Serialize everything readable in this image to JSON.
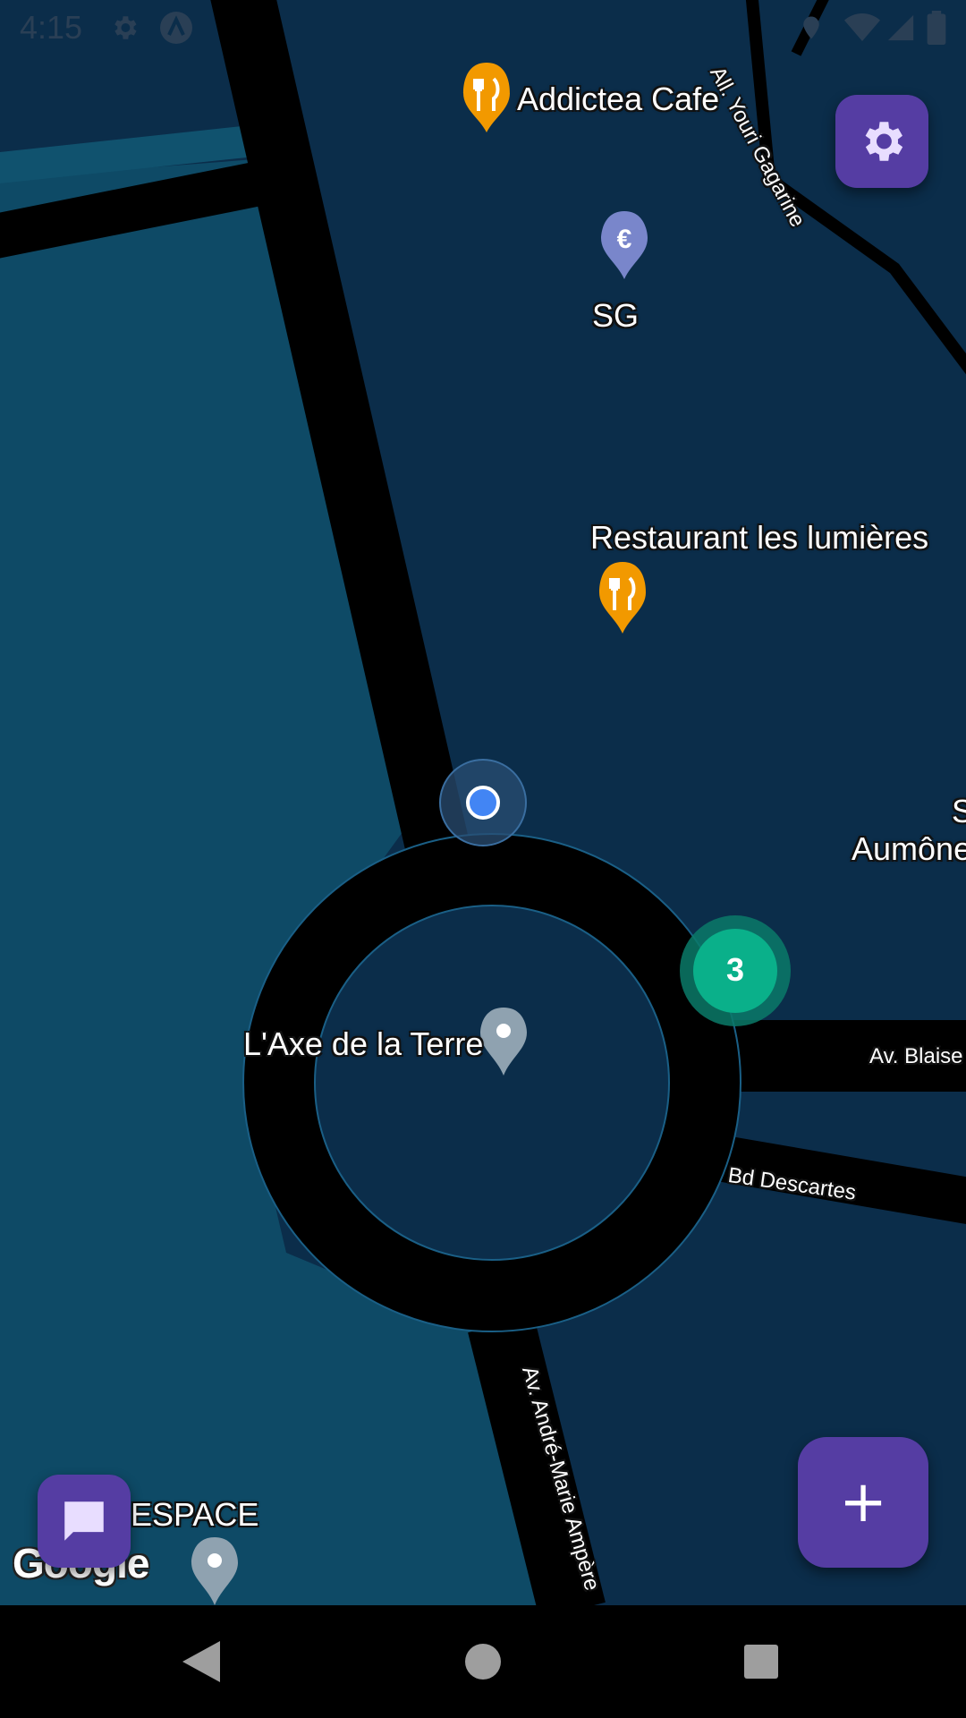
{
  "status_bar": {
    "time": "4:15",
    "icons": [
      "gear-icon",
      "a-logo-icon",
      "location-icon",
      "wifi-icon",
      "signal-icon",
      "battery-icon"
    ]
  },
  "map": {
    "pois": [
      {
        "name": "Addictea Cafe",
        "icon": "restaurant-pin-icon"
      },
      {
        "name": "SG",
        "icon": "euro-pin-icon"
      },
      {
        "name": "Restaurant les lumières",
        "icon": "restaurant-pin-icon"
      },
      {
        "name": "L'Axe de la Terre",
        "icon": "place-pin-icon"
      },
      {
        "name": "ESPACE",
        "icon": "place-pin-icon"
      },
      {
        "name": "Aumône",
        "icon": "none"
      },
      {
        "name": "S",
        "icon": "none"
      }
    ],
    "streets": [
      "All. Youri Gagarine",
      "Av. Blaise",
      "Bd Descartes",
      "Av. André-Marie Ampère"
    ],
    "cluster_count": "3",
    "logo": "Google"
  },
  "colors": {
    "accent": "#553da3",
    "cluster": "#0ab08a",
    "location_dot": "#4285f4",
    "restaurant_pin": "#f29900",
    "euro_pin": "#7986cb",
    "place_pin": "#8fa2b0"
  },
  "buttons": {
    "settings": "settings-icon",
    "add": "+",
    "chat": "chat-icon"
  },
  "nav": [
    "back-icon",
    "home-icon",
    "recents-icon"
  ]
}
